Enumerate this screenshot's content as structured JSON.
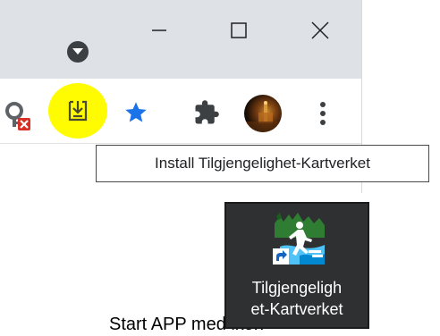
{
  "browser": {
    "window_controls": {
      "minimize_icon": "minimize-icon",
      "maximize_icon": "maximize-icon",
      "close_icon": "close-icon"
    },
    "profile_dropdown_icon": "chevron-down-icon",
    "toolbar": {
      "icons": [
        "key-blocked-icon",
        "install-app-icon",
        "bookmark-star-icon",
        "extensions-puzzle-icon",
        "profile-avatar",
        "more-menu-icon"
      ],
      "install_highlight_color": "#fffb00",
      "star_color": "#1a73e8"
    },
    "tooltip": {
      "text": "Install Tilgjengelighet-Kartverket"
    }
  },
  "instruction": {
    "caption": "Start APP med ikon"
  },
  "desktop_shortcut": {
    "label_line1": "Tilgjengeligh",
    "label_line2": "et-Kartverket",
    "icon": "accessibility-map-app-icon"
  }
}
